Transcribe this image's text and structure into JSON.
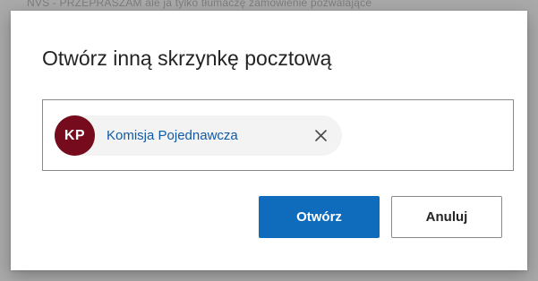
{
  "backdrop": {
    "text": "NVS - PRZEPRASZAM ale ja tylko tłumaczę zamówienie pozwalające"
  },
  "dialog": {
    "title": "Otwórz inną skrzynkę pocztową",
    "picker": {
      "selected": {
        "initials": "KP",
        "name": "Komisja Pojednawcza",
        "avatar_color": "#750b1c"
      },
      "remove_icon": "close-icon"
    },
    "buttons": {
      "primary_label": "Otwórz",
      "secondary_label": "Anuluj"
    }
  },
  "colors": {
    "primary": "#0f6cbd",
    "persona_name": "#0f5ba7",
    "avatar": "#750b1c"
  }
}
